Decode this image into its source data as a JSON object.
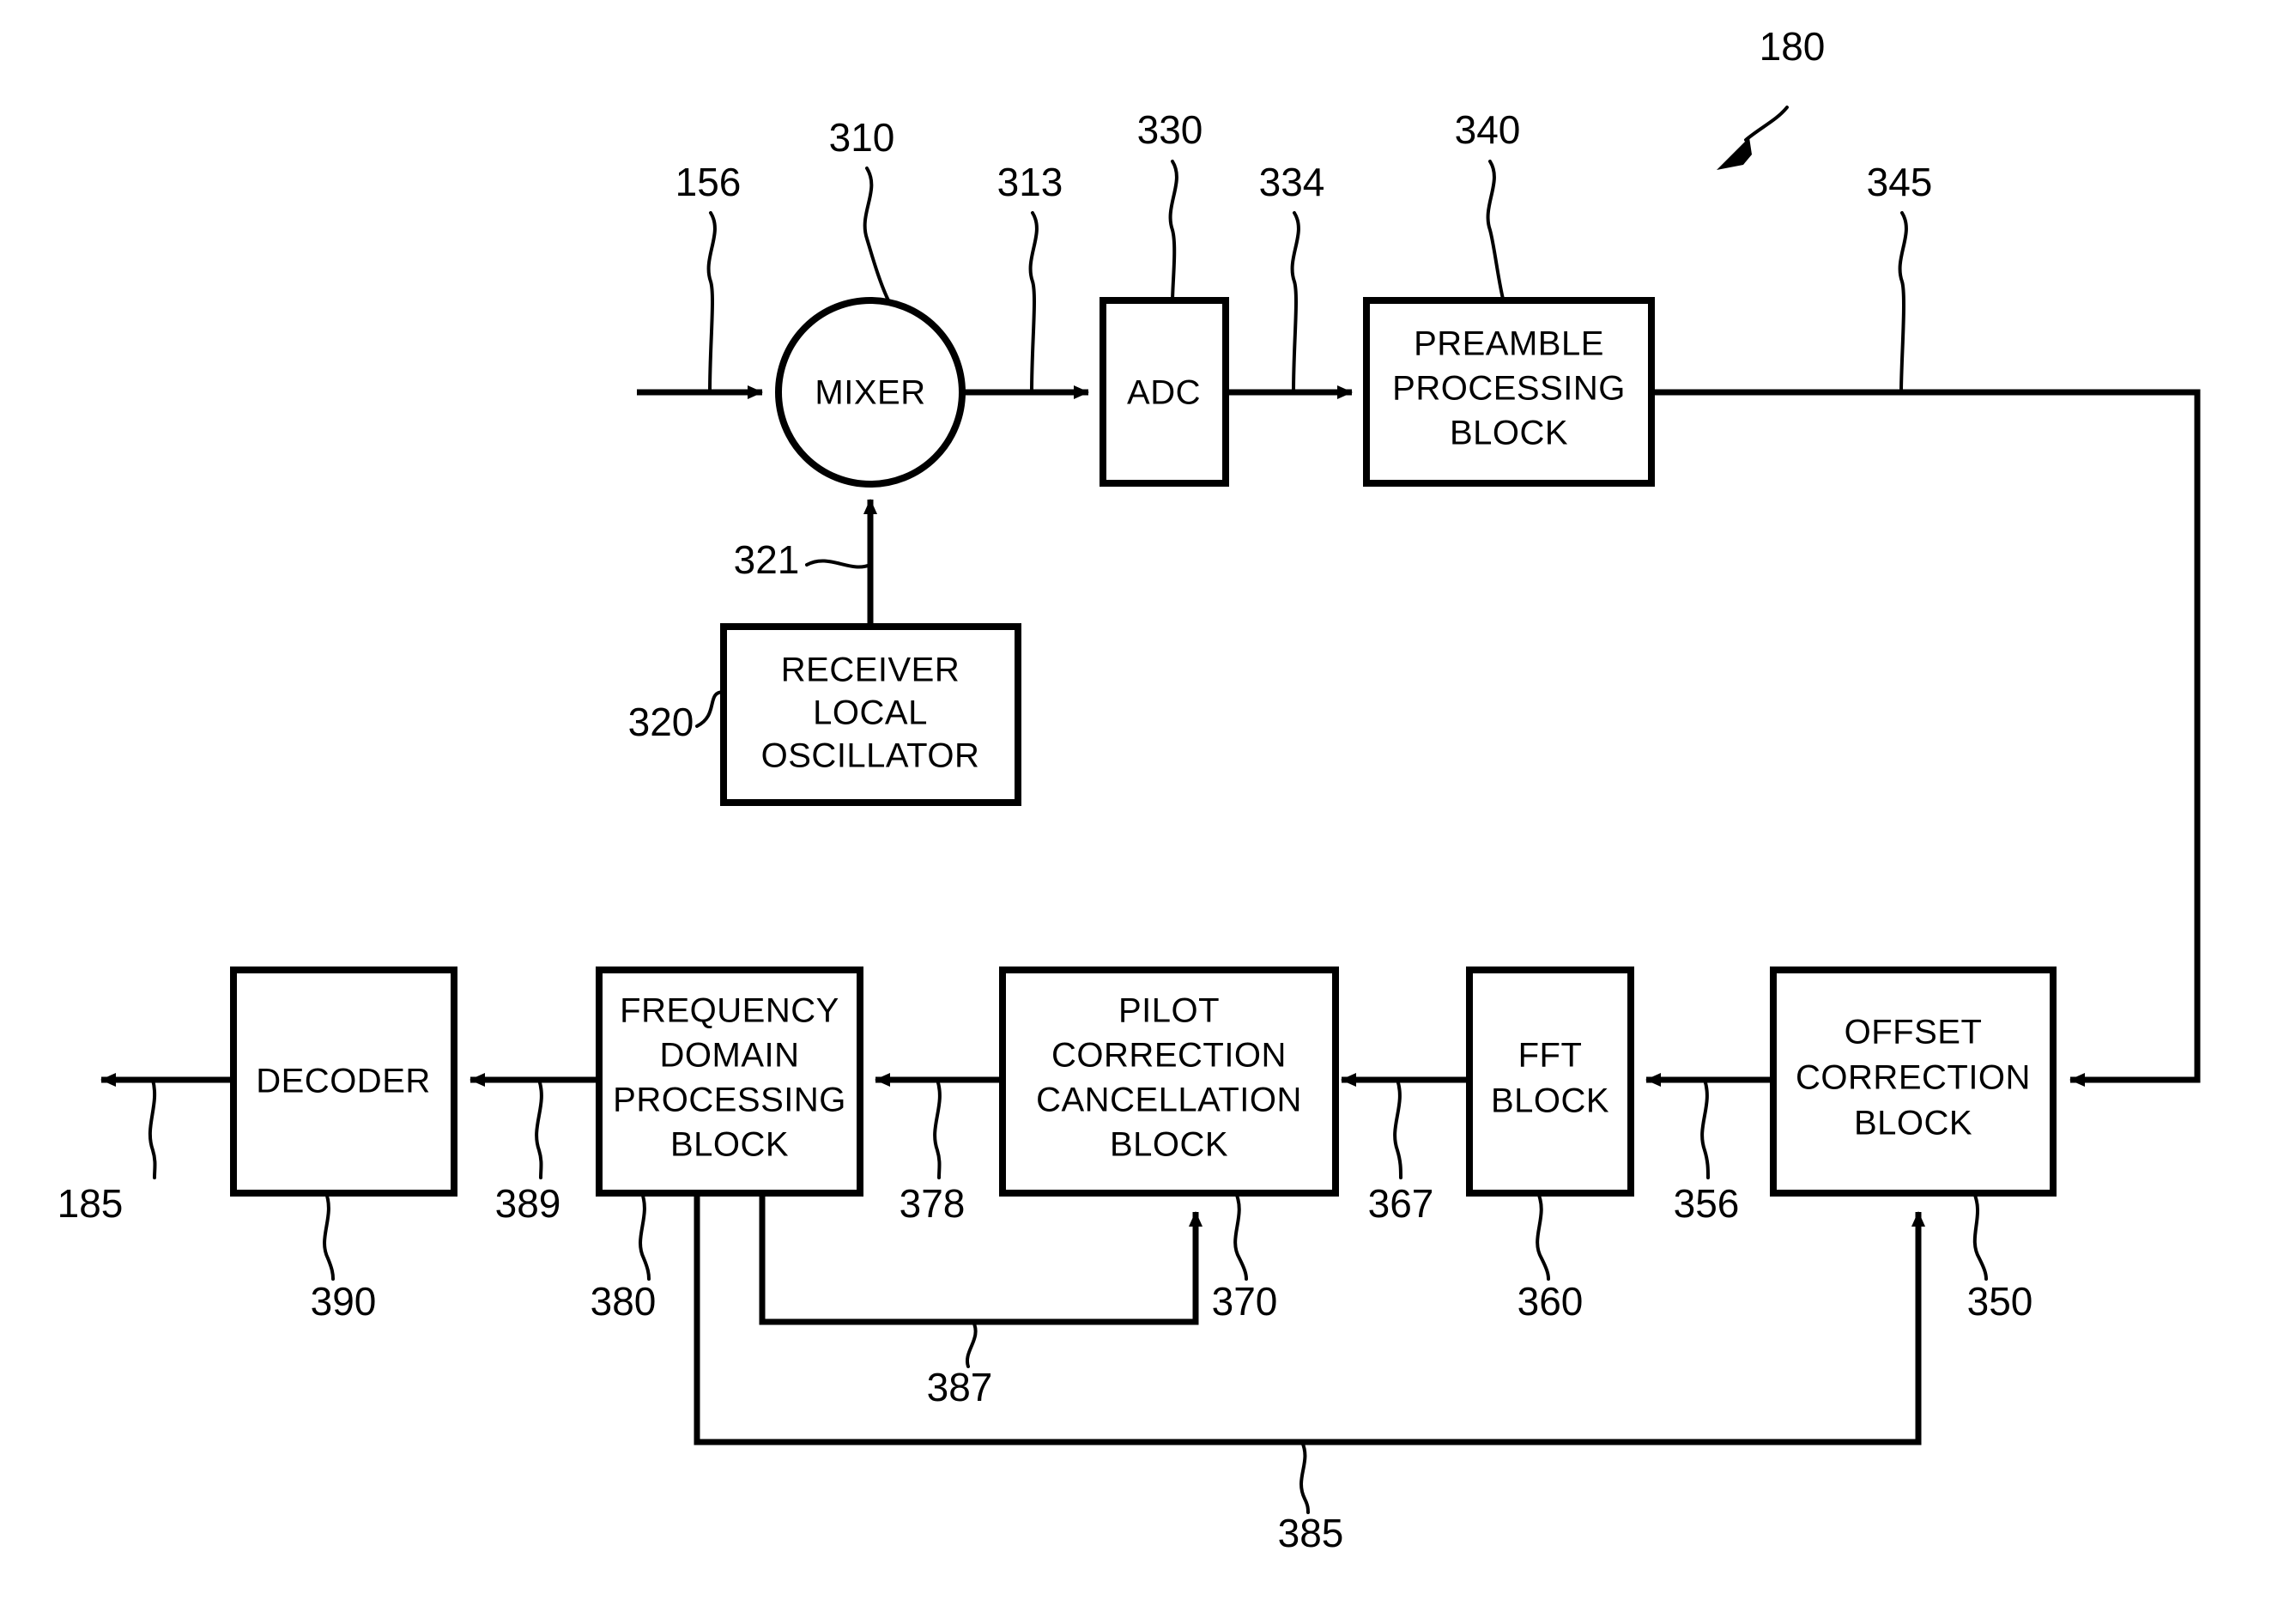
{
  "figure": {
    "label": "180",
    "type": "receiver-block-diagram"
  },
  "blocks": [
    {
      "id": "mixer",
      "shape": "circle",
      "label": "MIXER",
      "ref": "310",
      "lines": [
        "MIXER"
      ]
    },
    {
      "id": "rlo",
      "shape": "rect",
      "label": "RECEIVER LOCAL OSCILLATOR",
      "ref": "320",
      "lines": [
        "RECEIVER",
        "LOCAL",
        "OSCILLATOR"
      ]
    },
    {
      "id": "adc",
      "shape": "rect",
      "label": "ADC",
      "ref": "330",
      "lines": [
        "ADC"
      ]
    },
    {
      "id": "preamble",
      "shape": "rect",
      "label": "PREAMBLE PROCESSING BLOCK",
      "ref": "340",
      "lines": [
        "PREAMBLE",
        "PROCESSING",
        "BLOCK"
      ]
    },
    {
      "id": "offset",
      "shape": "rect",
      "label": "OFFSET CORRECTION BLOCK",
      "ref": "350",
      "lines": [
        "OFFSET",
        "CORRECTION",
        "BLOCK"
      ]
    },
    {
      "id": "fft",
      "shape": "rect",
      "label": "FFT BLOCK",
      "ref": "360",
      "lines": [
        "FFT",
        "BLOCK"
      ]
    },
    {
      "id": "pilot",
      "shape": "rect",
      "label": "PILOT CORRECTION CANCELLATION BLOCK",
      "ref": "370",
      "lines": [
        "PILOT",
        "CORRECTION",
        "CANCELLATION",
        "BLOCK"
      ]
    },
    {
      "id": "freqdom",
      "shape": "rect",
      "label": "FREQUENCY DOMAIN PROCESSING BLOCK",
      "ref": "380",
      "lines": [
        "FREQUENCY",
        "DOMAIN",
        "PROCESSING",
        "BLOCK"
      ]
    },
    {
      "id": "decoder",
      "shape": "rect",
      "label": "DECODER",
      "ref": "390",
      "lines": [
        "DECODER"
      ]
    }
  ],
  "block_text": {
    "mixer_l1": "MIXER",
    "rlo_l1": "RECEIVER",
    "rlo_l2": "LOCAL",
    "rlo_l3": "OSCILLATOR",
    "adc_l1": "ADC",
    "preamble_l1": "PREAMBLE",
    "preamble_l2": "PROCESSING",
    "preamble_l3": "BLOCK",
    "offset_l1": "OFFSET",
    "offset_l2": "CORRECTION",
    "offset_l3": "BLOCK",
    "fft_l1": "FFT",
    "fft_l2": "BLOCK",
    "pilot_l1": "PILOT",
    "pilot_l2": "CORRECTION",
    "pilot_l3": "CANCELLATION",
    "pilot_l4": "BLOCK",
    "freqdom_l1": "FREQUENCY",
    "freqdom_l2": "DOMAIN",
    "freqdom_l3": "PROCESSING",
    "freqdom_l4": "BLOCK",
    "decoder_l1": "DECODER"
  },
  "reference_numerals": {
    "figure": "180",
    "input_signal": "156",
    "mixer": "310",
    "mixer_output": "313",
    "lo_output": "321",
    "local_oscillator": "320",
    "adc": "330",
    "adc_output": "334",
    "preamble_block": "340",
    "preamble_output": "345",
    "offset_block": "350",
    "offset_output": "356",
    "fft_block": "360",
    "fft_output": "367",
    "pilot_block": "370",
    "pilot_output": "378",
    "freqdom_block": "380",
    "freqdom_output": "389",
    "feedback_to_pilot": "387",
    "feedback_to_offset": "385",
    "decoder_output": "185",
    "decoder_block": "390"
  },
  "colors": {
    "stroke": "#000000",
    "background": "#ffffff"
  }
}
